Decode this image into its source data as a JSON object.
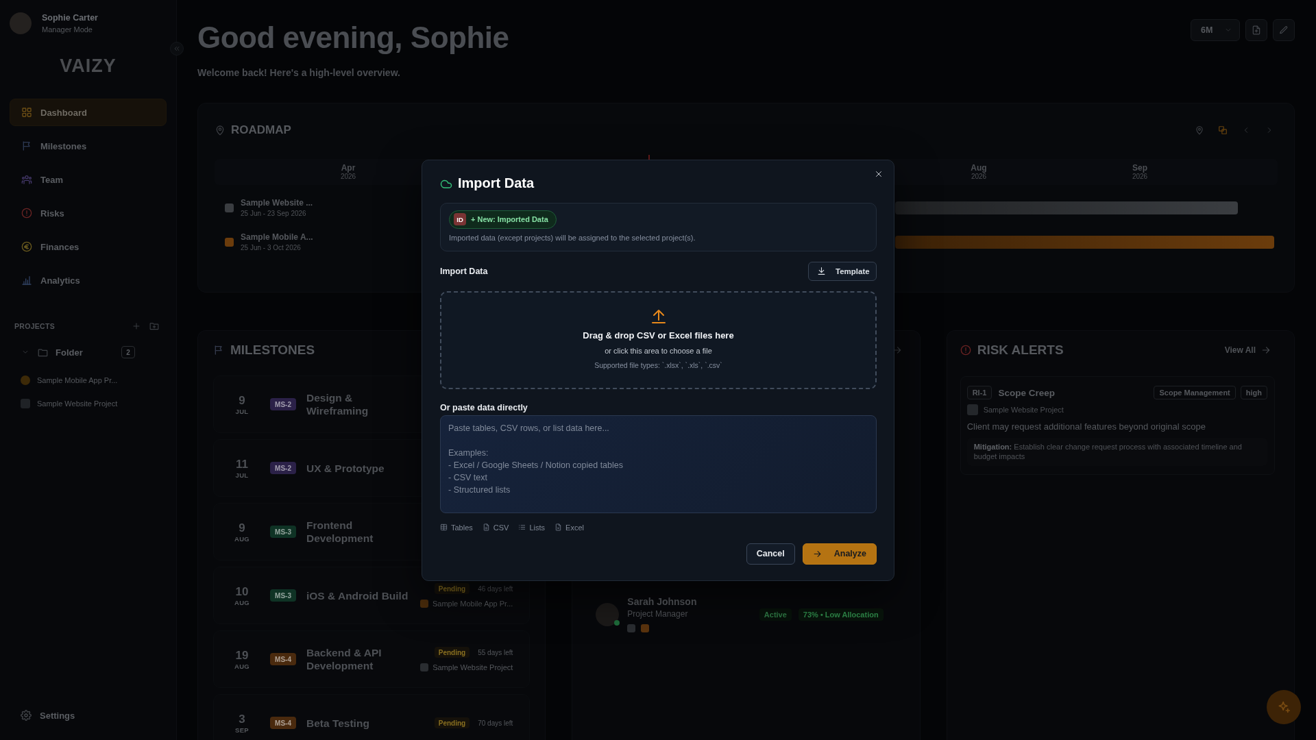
{
  "sidebar": {
    "user": {
      "name": "Sophie Carter",
      "role": "Manager Mode"
    },
    "logo": "VAIZY",
    "nav": [
      {
        "label": "Dashboard",
        "selected": true
      },
      {
        "label": "Milestones",
        "selected": false
      },
      {
        "label": "Team",
        "selected": false
      },
      {
        "label": "Risks",
        "selected": false
      },
      {
        "label": "Finances",
        "selected": false
      },
      {
        "label": "Analytics",
        "selected": false
      }
    ],
    "projects_title": "PROJECTS",
    "folders": [
      {
        "name": "Folder",
        "count": "2",
        "expanded": true,
        "children": [
          {
            "name": "Sample Mobile App Pr...",
            "color": "#3d2a08"
          },
          {
            "name": "Sample Website Project",
            "color": "#1f2226"
          }
        ]
      }
    ],
    "settings": "Settings"
  },
  "header": {
    "greeting": "Good evening, Sophie",
    "subtitle": "Welcome back! Here's a high-level overview.",
    "range": "6M"
  },
  "roadmap": {
    "title": "ROADMAP",
    "months": [
      {
        "name": "Apr",
        "year": "2026"
      },
      {
        "name": "Aug",
        "year": "2026"
      },
      {
        "name": "Sep",
        "year": "2026"
      }
    ],
    "rows": [
      {
        "name": "Sample Website ...",
        "dates": "25 Jun - 23 Sep 2026",
        "color": "#3a3d41"
      },
      {
        "name": "Sample Mobile A...",
        "dates": "25 Jun - 3 Oct 2026",
        "color": "#6b3c0c"
      }
    ]
  },
  "milestones": {
    "title": "MILESTONES",
    "items": [
      {
        "day": "9",
        "month": "JUL",
        "code": "MS-2",
        "color": "#2b2148",
        "title": "Design & Wireframing"
      },
      {
        "day": "11",
        "month": "JUL",
        "code": "MS-2",
        "color": "#2b2148",
        "title": "UX & Prototype"
      },
      {
        "day": "9",
        "month": "AUG",
        "code": "MS-3",
        "color": "#0f3325",
        "title": "Frontend Development"
      },
      {
        "day": "10",
        "month": "AUG",
        "code": "MS-3",
        "color": "#0f3325",
        "title": "iOS & Android Build",
        "status": "Pending",
        "days_left": "46 days left",
        "project": {
          "name": "Sample Mobile App Pr...",
          "color": "#4a2c0c"
        }
      },
      {
        "day": "19",
        "month": "AUG",
        "code": "MS-4",
        "color": "#4a2a0e",
        "title": "Backend & API Development",
        "status": "Pending",
        "days_left": "55 days left",
        "project": {
          "name": "Sample Website Project",
          "color": "#2a2d31"
        }
      },
      {
        "day": "3",
        "month": "SEP",
        "code": "MS-4",
        "color": "#4a2a0e",
        "title": "Beta Testing",
        "status": "Pending",
        "days_left": "70 days left"
      }
    ]
  },
  "team": {
    "members": [
      {
        "name": "Sarah Johnson",
        "role": "Project Manager",
        "online": true,
        "status": "Active",
        "allocation": "73% • Low Allocation",
        "projects": [
          {
            "color": "#2a2d31"
          },
          {
            "color": "#5a330e"
          }
        ]
      }
    ]
  },
  "risks": {
    "title": "RISK ALERTS",
    "view_all": "View All",
    "items": [
      {
        "code": "RI-1",
        "title": "Scope Creep",
        "category": "Scope Management",
        "severity": "high",
        "project": {
          "name": "Sample Website Project",
          "color": "#24272b"
        },
        "description": "Client may request additional features beyond original scope",
        "mitigation": "**Mitigation:** Establish clear change request process with associated timeline and budget impacts"
      }
    ]
  },
  "modal": {
    "title": "Import Data",
    "project_tag": {
      "badge": "ID",
      "label": "+ New: Imported Data"
    },
    "note": "Imported data (except projects) will be assigned to the selected project(s).",
    "section_label": "Import Data",
    "template_button": "Template",
    "dropzone": {
      "title": "Drag & drop CSV or Excel files here",
      "subtitle": "or click this area to choose a file",
      "types": "Supported file types: `.xlsx`, `.xls`, `.csv`"
    },
    "paste_label": "Or paste data directly",
    "paste_field": {
      "placeholder": "Paste tables, CSV rows, or list data here...\n\nExamples:\n- Excel / Google Sheets / Notion copied tables\n- CSV text\n- Structured lists"
    },
    "formats": [
      "Tables",
      "CSV",
      "Lists",
      "Excel"
    ],
    "buttons": [
      {
        "label": "Cancel",
        "kind": "secondary"
      },
      {
        "label": "Analyze",
        "kind": "primary"
      }
    ]
  }
}
